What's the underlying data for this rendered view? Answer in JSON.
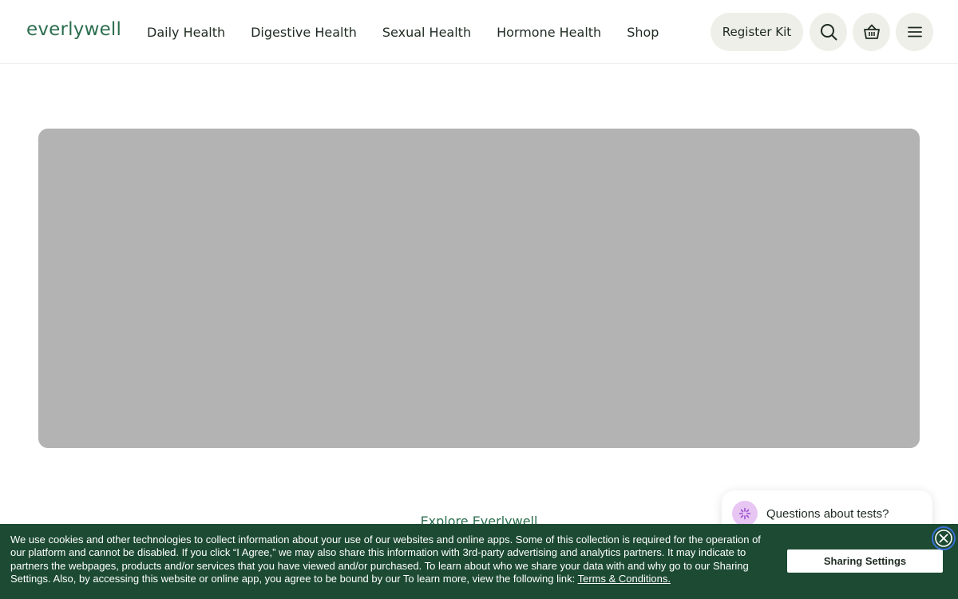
{
  "header": {
    "logo_text": "everlywell",
    "nav": [
      "Daily Health",
      "Digestive Health",
      "Sexual Health",
      "Hormone Health",
      "Shop"
    ],
    "register_label": "Register Kit"
  },
  "icons": {
    "search": "search-icon",
    "cart": "basket-icon",
    "menu": "hamburger-menu-icon",
    "chat": "sparkle-icon",
    "close": "close-icon"
  },
  "main": {
    "explore_label": "Explore Everlywell"
  },
  "chat": {
    "prompt": "Questions about tests?"
  },
  "cookie": {
    "text": "We use cookies and other technologies to collect information about your use of our websites and online apps. Some of this collection is required for the operation of our platform and cannot be disabled. If you click “I Agree,” we may also share this information with 3rd-party advertising and analytics partners. It may indicate to partners the webpages, products and/or services that you have viewed and/or purchased. To learn about who we share your data with and why go to our Sharing Settings. Also, by accessing this website or online app, you agree to be bound by our To learn more, view the following link: ",
    "link_label": "Terms & Conditions.",
    "sharing_label": "Sharing Settings"
  },
  "colors": {
    "brand_green": "#2c6e4f",
    "cookie_bg": "#1c4a33",
    "pill_bg": "#efefe9",
    "hero_placeholder": "#b3b3b3",
    "chat_avatar": "#e8c6f3"
  }
}
